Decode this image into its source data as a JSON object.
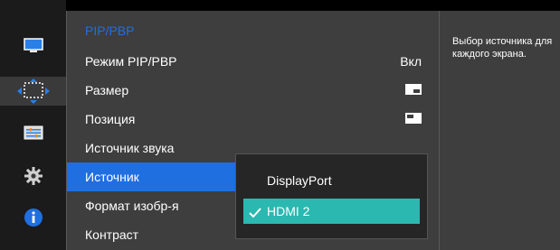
{
  "icons": {
    "rail": [
      "picture-icon",
      "onscreen-display-icon",
      "system-icon",
      "settings-gear-icon",
      "info-icon"
    ]
  },
  "colors": {
    "accent_blue": "#1f6fe0",
    "check_teal": "#2ab8b0",
    "panel_bg": "#3e3e3e",
    "rail_bg": "#1b1b1b"
  },
  "menu": {
    "title": "PIP/PBP",
    "items": [
      {
        "label": "Режим PIP/PBP",
        "value": "Вкл"
      },
      {
        "label": "Размер",
        "value": ""
      },
      {
        "label": "Позиция",
        "value": ""
      },
      {
        "label": "Источник звука",
        "value": ""
      },
      {
        "label": "Источник",
        "value": ""
      },
      {
        "label": "Формат изобр-я",
        "value": ""
      },
      {
        "label": "Контраст",
        "value": ""
      }
    ]
  },
  "submenu": {
    "options": [
      {
        "label": "DisplayPort",
        "checked": false
      },
      {
        "label": "HDMI 2",
        "checked": true
      }
    ]
  },
  "description": {
    "text": "Выбор источника для каждого экрана."
  }
}
